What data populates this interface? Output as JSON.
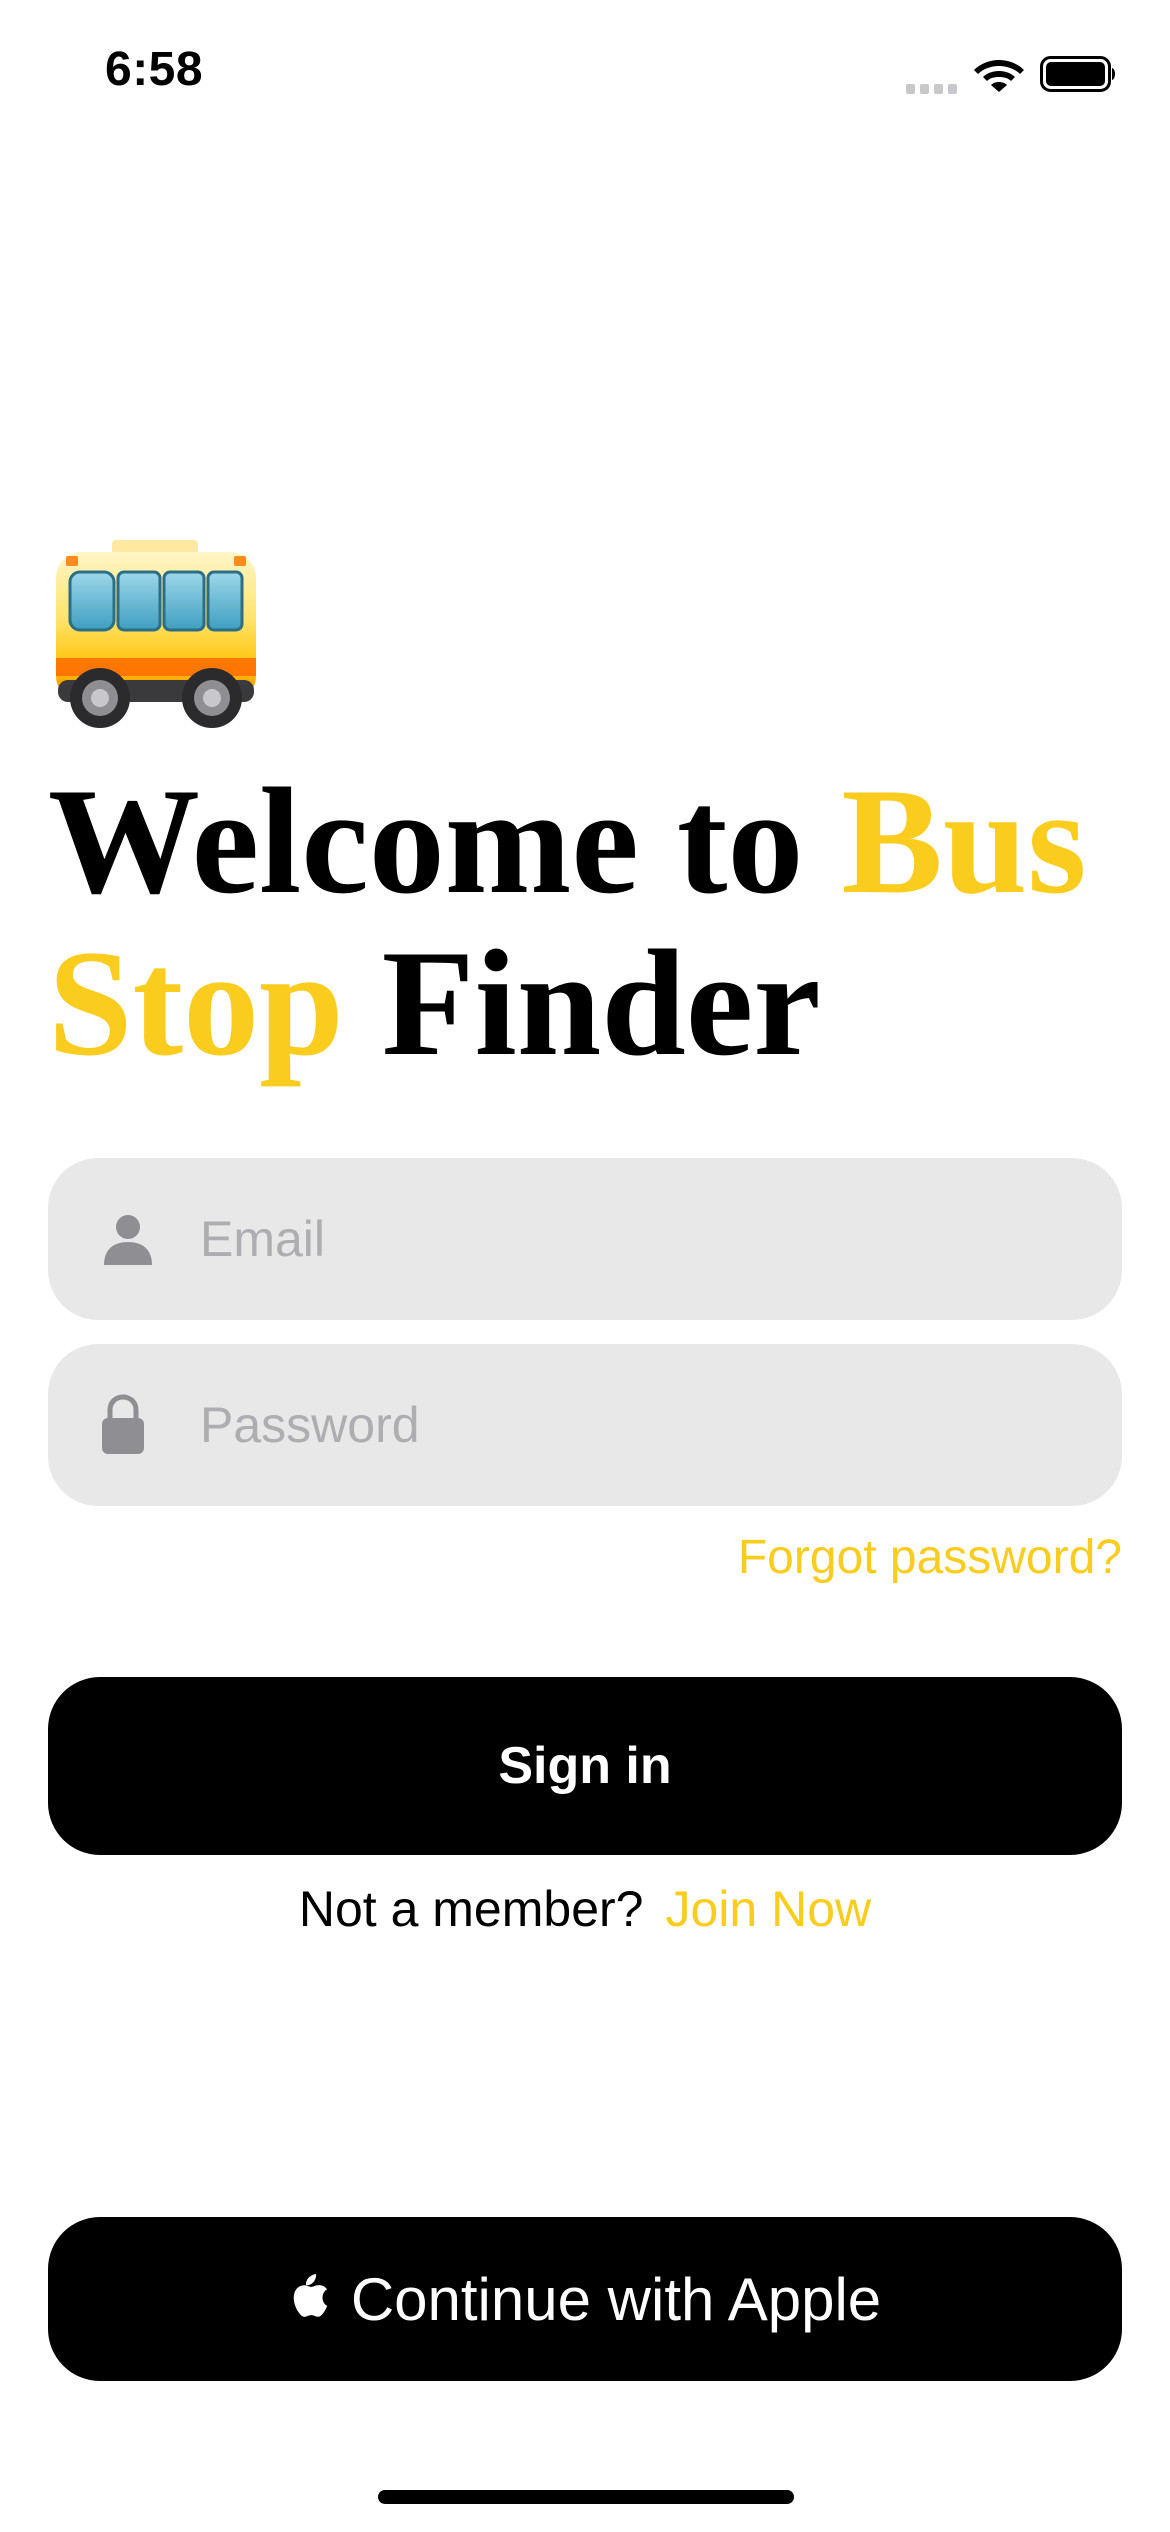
{
  "status_bar": {
    "time": "6:58",
    "icons": [
      "cellular-signal-icon",
      "wifi-icon",
      "battery-icon"
    ]
  },
  "illustration": {
    "icon": "bus-icon"
  },
  "title": {
    "part1": "Welcome to ",
    "accent1": "Bus",
    "accent2": "Stop",
    "part2": " Finder"
  },
  "form": {
    "email_placeholder": "Email",
    "email_icon": "person-icon",
    "password_placeholder": "Password",
    "password_icon": "lock-icon",
    "forgot_password": "Forgot password?"
  },
  "sign_in": {
    "label": "Sign in"
  },
  "membership": {
    "prompt": "Not a member?",
    "join_label": "Join Now"
  },
  "apple_signin": {
    "label": "Continue with Apple",
    "icon": "apple-logo-icon"
  },
  "colors": {
    "accent": "#F9CC1E",
    "field_background": "#E8E8E8",
    "button_background": "#000000",
    "placeholder": "#AEAEB2"
  }
}
